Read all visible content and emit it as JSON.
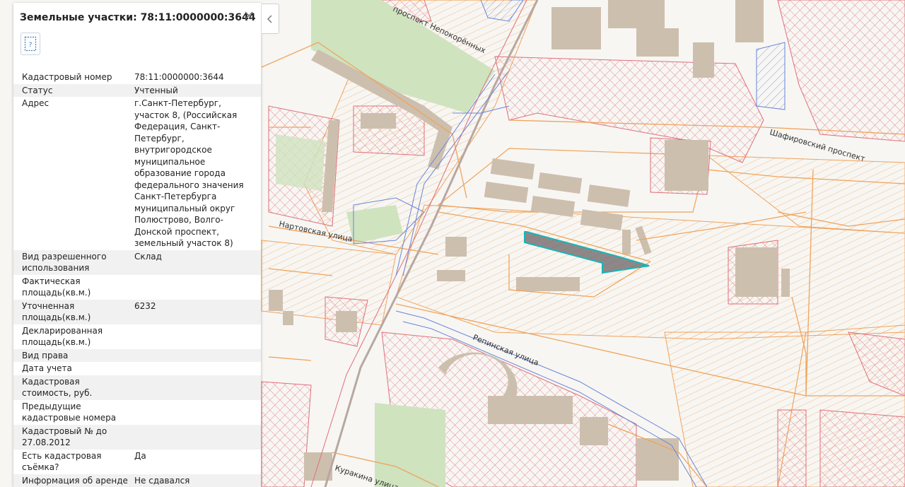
{
  "panel": {
    "title": "Земельные участки: 78:11:0000000:3644",
    "doc_icon_label": "?",
    "rows": [
      {
        "key": "Кадастровый номер",
        "value": "78:11:0000000:3644"
      },
      {
        "key": "Статус",
        "value": "Учтенный"
      },
      {
        "key": "Адрес",
        "value": "г.Санкт-Петербург, участок 8, (Российская Федерация, Санкт-Петербург, внутригородское муниципальное образование города федерального значения Санкт-Петербурга муниципальный округ Полюстрово, Волго-Донской проспект, земельный участок 8)"
      },
      {
        "key": "Вид разрешенного использования",
        "value": "Склад"
      },
      {
        "key": "Фактическая площадь(кв.м.)",
        "value": ""
      },
      {
        "key": "Уточненная площадь(кв.м.)",
        "value": "6232"
      },
      {
        "key": "Декларированная площадь(кв.м.)",
        "value": ""
      },
      {
        "key": "Вид права",
        "value": ""
      },
      {
        "key": "Дата учета",
        "value": ""
      },
      {
        "key": "Кадастровая стоимость, руб.",
        "value": ""
      },
      {
        "key": "Предыдущие кадастровые номера",
        "value": ""
      },
      {
        "key": "Кадастровый № до 27.08.2012",
        "value": ""
      },
      {
        "key": "Есть кадастровая съёмка?",
        "value": "Да"
      },
      {
        "key": "Информация об аренде",
        "value": "Не сдавался"
      }
    ]
  },
  "map": {
    "streets": {
      "nepokorennykh": "проспект Непокорённых",
      "shafirovsky": "Шафировский проспект",
      "nartovskaya": "Нартовская улица",
      "repinskaya": "Репинская улица",
      "kurakina": "Куракина улица"
    },
    "colors": {
      "background": "#f7f6f3",
      "parcel_orange": "#f0a35a",
      "hatch_red": "#e0707a",
      "building": "#cdbfae",
      "green": "#cfe3bf",
      "blue_line": "#6a86d8",
      "selected_outline": "#19b5b5",
      "selected_fill": "#6b6266"
    }
  }
}
